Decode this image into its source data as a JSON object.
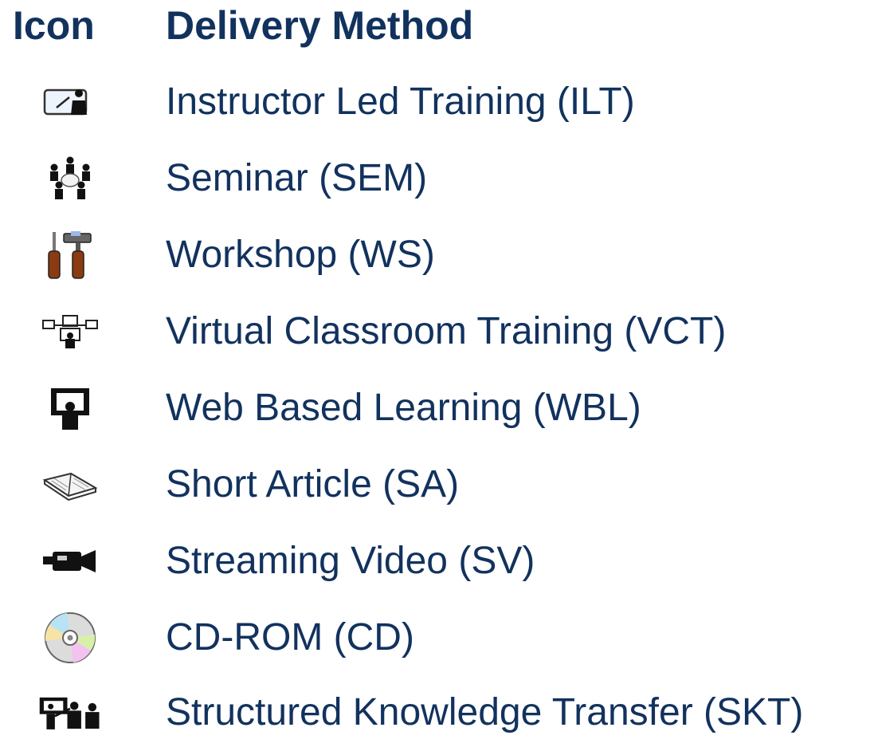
{
  "header": {
    "icon": "Icon",
    "method": "Delivery Method"
  },
  "rows": [
    {
      "icon": "instructor-board-icon",
      "label": "Instructor Led Training (ILT)"
    },
    {
      "icon": "seminar-group-icon",
      "label": "Seminar (SEM)"
    },
    {
      "icon": "tools-icon",
      "label": "Workshop (WS)"
    },
    {
      "icon": "network-computers-icon",
      "label": "Virtual Classroom Training (VCT)"
    },
    {
      "icon": "web-monitor-icon",
      "label": "Web Based Learning (WBL)"
    },
    {
      "icon": "open-book-icon",
      "label": "Short Article (SA)"
    },
    {
      "icon": "video-camera-icon",
      "label": "Streaming Video (SV)"
    },
    {
      "icon": "cd-rom-icon",
      "label": "CD-ROM (CD)"
    },
    {
      "icon": "presenter-audience-icon",
      "label": "Structured Knowledge Transfer (SKT)"
    }
  ],
  "colors": {
    "text": "#12325e",
    "background": "#ffffff"
  }
}
